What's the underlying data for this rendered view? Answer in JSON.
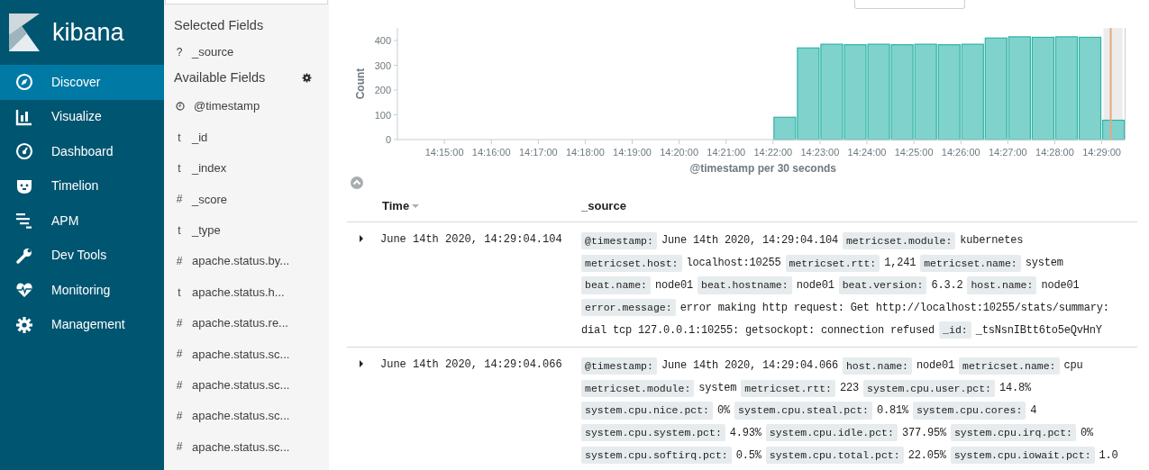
{
  "sidebar": {
    "logo": "kibana",
    "items": [
      {
        "label": "Discover",
        "selected": true
      },
      {
        "label": "Visualize",
        "selected": false
      },
      {
        "label": "Dashboard",
        "selected": false
      },
      {
        "label": "Timelion",
        "selected": false
      },
      {
        "label": "APM",
        "selected": false
      },
      {
        "label": "Dev Tools",
        "selected": false
      },
      {
        "label": "Monitoring",
        "selected": false
      },
      {
        "label": "Management",
        "selected": false
      }
    ]
  },
  "fields_panel": {
    "selected_title": "Selected Fields",
    "selected_fields": [
      {
        "kind": "char",
        "type": "?",
        "name": "_source"
      }
    ],
    "available_title": "Available Fields",
    "available_fields": [
      {
        "kind": "date",
        "name": "@timestamp"
      },
      {
        "kind": "char",
        "type": "t",
        "name": "_id"
      },
      {
        "kind": "char",
        "type": "t",
        "name": "_index"
      },
      {
        "kind": "char",
        "type": "#",
        "name": "_score"
      },
      {
        "kind": "char",
        "type": "t",
        "name": "_type"
      },
      {
        "kind": "char",
        "type": "#",
        "name": "apache.status.by..."
      },
      {
        "kind": "char",
        "type": "t",
        "name": "apache.status.h..."
      },
      {
        "kind": "char",
        "type": "#",
        "name": "apache.status.re..."
      },
      {
        "kind": "char",
        "type": "#",
        "name": "apache.status.sc..."
      },
      {
        "kind": "char",
        "type": "#",
        "name": "apache.status.sc..."
      },
      {
        "kind": "char",
        "type": "#",
        "name": "apache.status.sc..."
      },
      {
        "kind": "char",
        "type": "#",
        "name": "apache.status.sc..."
      }
    ]
  },
  "histogram": {
    "chart_data": {
      "type": "bar",
      "xlabel": "@timestamp per 30 seconds",
      "ylabel": "Count",
      "categories": [
        null,
        "14:15:00",
        null,
        "14:16:00",
        null,
        "14:17:00",
        null,
        "14:18:00",
        null,
        "14:19:00",
        null,
        "14:20:00",
        null,
        "14:21:00",
        null,
        "14:22:00",
        null,
        "14:23:00",
        null,
        "14:24:00",
        null,
        "14:25:00",
        null,
        "14:26:00",
        null,
        "14:27:00",
        null,
        "14:28:00",
        null,
        "14:29:00"
      ],
      "series": [
        {
          "color": "#7fd3cc",
          "values": [
            null,
            null,
            null,
            null,
            null,
            null,
            null,
            null,
            null,
            null,
            null,
            null,
            null,
            null,
            null,
            90,
            370,
            385,
            383,
            385,
            383,
            385,
            383,
            385,
            410,
            415,
            413,
            415,
            413,
            78
          ]
        }
      ],
      "ylim": [
        0,
        450
      ],
      "yticks": [
        {
          "value": 0,
          "label": "0"
        },
        {
          "value": 100,
          "label": "100"
        },
        {
          "value": 200,
          "label": "200"
        },
        {
          "value": 300,
          "label": "300"
        },
        {
          "value": 400,
          "label": "400"
        }
      ]
    }
  },
  "table": {
    "columns": [
      {
        "label": "Time",
        "sorted": true
      },
      {
        "label": "_source",
        "sorted": false
      }
    ],
    "rows": [
      {
        "expanded": false,
        "time": "June 14th 2020, 14:29:04.104",
        "lines": [
          [
            {
              "key": "@timestamp:",
              "value": "June 14th 2020, 14:29:04.104"
            },
            {
              "key": "metricset.module:",
              "value": "kubernetes"
            }
          ],
          [
            {
              "key": "metricset.host:",
              "value": "localhost:10255"
            },
            {
              "key": "metricset.rtt:",
              "value": "1,241"
            },
            {
              "key": "metricset.name:",
              "value": "system"
            }
          ],
          [
            {
              "key": "beat.name:",
              "value": "node01"
            },
            {
              "key": "beat.hostname:",
              "value": "node01"
            },
            {
              "key": "beat.version:",
              "value": "6.3.2"
            },
            {
              "key": "host.name:",
              "value": "node01"
            }
          ],
          [
            {
              "key": "error.message:",
              "value": "error making http request: Get http://localhost:10255/stats/summary:"
            }
          ],
          [
            {
              "value": "dial tcp 127.0.0.1:10255: getsockopt: connection refused"
            },
            {
              "key": "_id:",
              "value": "_tsNsnIBtt6to5eQvHnY"
            }
          ]
        ]
      },
      {
        "expanded": false,
        "time": "June 14th 2020, 14:29:04.066",
        "lines": [
          [
            {
              "key": "@timestamp:",
              "value": "June 14th 2020, 14:29:04.066"
            },
            {
              "key": "host.name:",
              "value": "node01"
            },
            {
              "key": "metricset.name:",
              "value": "cpu"
            }
          ],
          [
            {
              "key": "metricset.module:",
              "value": "system"
            },
            {
              "key": "metricset.rtt:",
              "value": "223"
            },
            {
              "key": "system.cpu.user.pct:",
              "value": "14.8%"
            }
          ],
          [
            {
              "key": "system.cpu.nice.pct:",
              "value": "0%"
            },
            {
              "key": "system.cpu.steal.pct:",
              "value": "0.81%"
            },
            {
              "key": "system.cpu.cores:",
              "value": "4"
            }
          ],
          [
            {
              "key": "system.cpu.system.pct:",
              "value": "4.93%"
            },
            {
              "key": "system.cpu.idle.pct:",
              "value": "377.95%"
            },
            {
              "key": "system.cpu.irq.pct:",
              "value": "0%"
            }
          ],
          [
            {
              "key": "system.cpu.softirq.pct:",
              "value": "0.5%"
            },
            {
              "key": "system.cpu.total.pct:",
              "value": "22.05%"
            },
            {
              "key": "system.cpu.iowait.pct:",
              "value": "1.0"
            }
          ]
        ]
      }
    ]
  }
}
